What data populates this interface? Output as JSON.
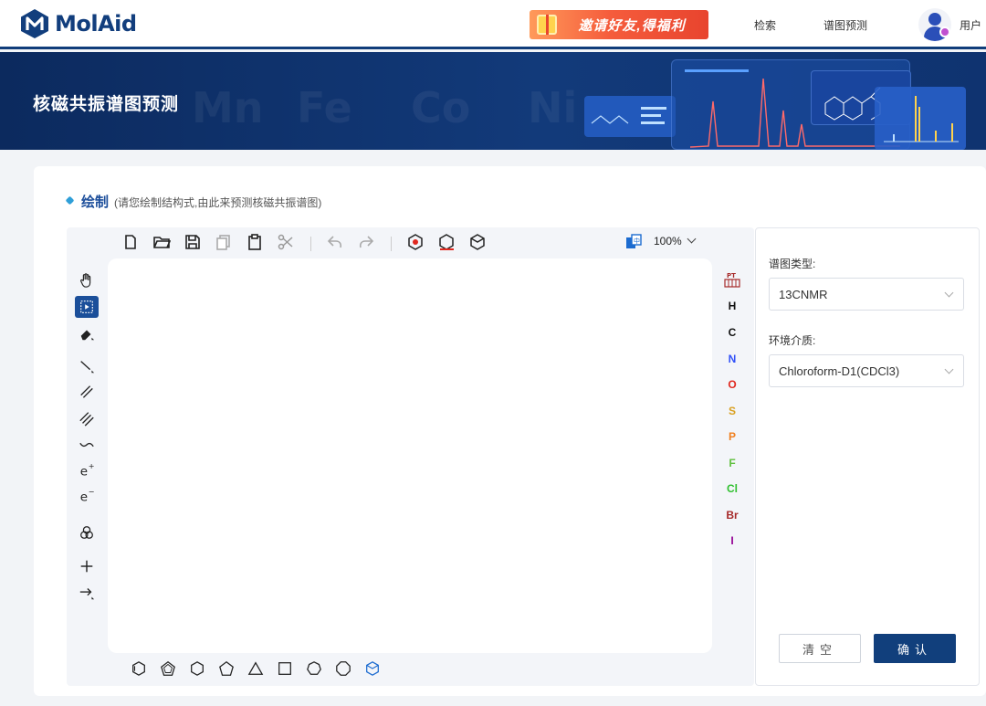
{
  "header": {
    "logo_text": "MolAid",
    "promo_text": "邀请好友,得福利",
    "nav": [
      "检索",
      "谱图预测"
    ],
    "user_label": "用户"
  },
  "banner": {
    "title": "核磁共振谱图预测"
  },
  "draw_section": {
    "title": "绘制",
    "subtitle": "(请您绘制结构式,由此来预测核磁共振谱图)"
  },
  "editor": {
    "top_toolbar_icons": [
      "new-document-icon",
      "open-folder-icon",
      "save-icon",
      "copy-icon",
      "paste-icon",
      "cut-icon",
      "undo-icon",
      "redo-icon",
      "layout-icon",
      "clean-icon",
      "3d-view-icon"
    ],
    "zoom": "100%",
    "left_tools": [
      "hand-icon",
      "select-icon",
      "eraser-icon",
      "single-bond-icon",
      "double-bond-icon",
      "triple-bond-icon",
      "wavy-bond-icon",
      "charge-plus-icon",
      "charge-minus-icon",
      "template-icon",
      "plus-icon",
      "reaction-arrow-icon"
    ],
    "atoms": [
      {
        "symbol": "H",
        "color": "#111111"
      },
      {
        "symbol": "C",
        "color": "#111111"
      },
      {
        "symbol": "N",
        "color": "#3050f8"
      },
      {
        "symbol": "O",
        "color": "#e0281f"
      },
      {
        "symbol": "S",
        "color": "#d9a020"
      },
      {
        "symbol": "P",
        "color": "#f08020"
      },
      {
        "symbol": "F",
        "color": "#60c040"
      },
      {
        "symbol": "Cl",
        "color": "#30c030"
      },
      {
        "symbol": "Br",
        "color": "#a62929"
      },
      {
        "symbol": "I",
        "color": "#940094"
      }
    ],
    "bottom_shapes": [
      "benzene-icon",
      "cyclopentadiene-icon",
      "cyclohexane-icon",
      "cyclopentane-icon",
      "cyclopropane-icon",
      "cyclobutane-icon",
      "cycloheptane-icon",
      "cyclooctane-icon",
      "template-library-icon"
    ]
  },
  "form": {
    "spectrum_type_label": "谱图类型:",
    "spectrum_type_value": "13CNMR",
    "solvent_label": "环境介质:",
    "solvent_value": "Chloroform-D1(CDCl3)",
    "clear_button": "清空",
    "confirm_button": "确认"
  },
  "colors": {
    "brand_navy": "#113f7c",
    "banner_bg": "#0c2a5e",
    "accent_blue": "#2f9fd8"
  }
}
